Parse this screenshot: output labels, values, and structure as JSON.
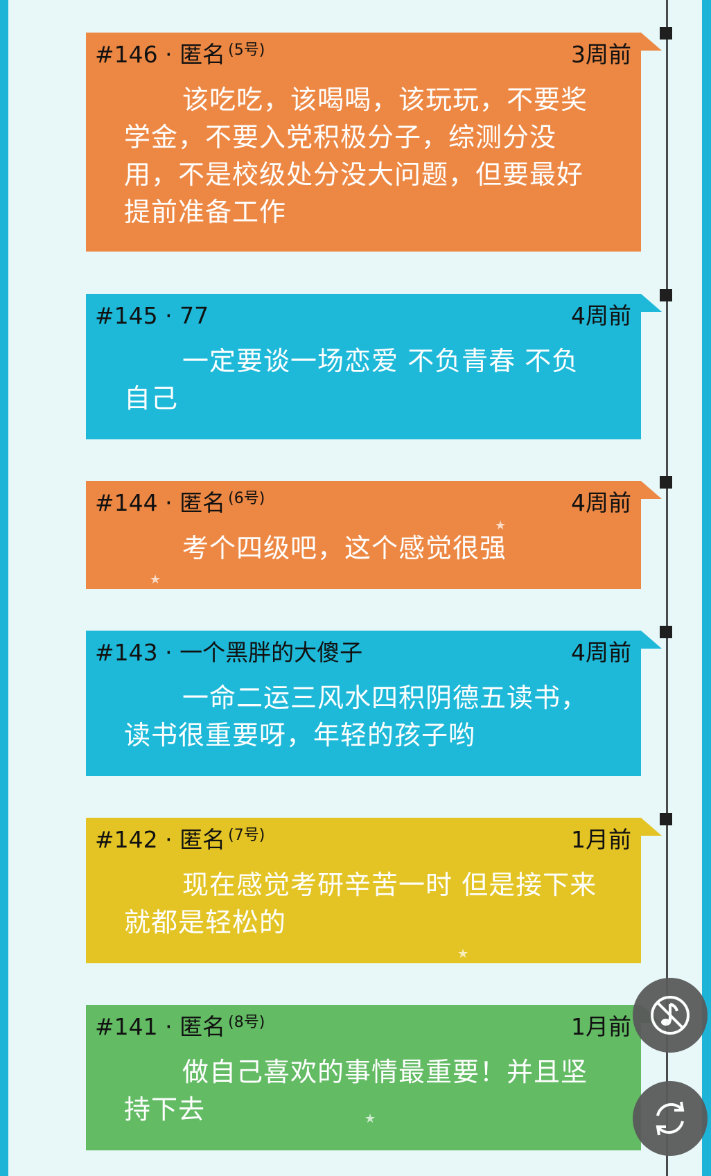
{
  "posts": [
    {
      "id": "#146",
      "sep": " · ",
      "author": "匿名",
      "tag": "(5号)",
      "time": "3周前",
      "text": "该吃吃，该喝喝，该玩玩，不要奖学金，不要入党积极分子，综测分没用，不是校级处分没大问题，但要最好提前准备工作",
      "color": "#ed8844"
    },
    {
      "id": "#145",
      "sep": " · ",
      "author": "77",
      "tag": "",
      "time": "4周前",
      "text": "一定要谈一场恋爱 不负青春 不负自己",
      "color": "#1eb9d9"
    },
    {
      "id": "#144",
      "sep": " · ",
      "author": "匿名",
      "tag": "(6号)",
      "time": "4周前",
      "text": "考个四级吧，这个感觉很强",
      "color": "#ed8844"
    },
    {
      "id": "#143",
      "sep": " · ",
      "author": "一个黑胖的大傻子",
      "tag": "",
      "time": "4周前",
      "text": "一命二运三风水四积阴德五读书，读书很重要呀，年轻的孩子哟",
      "color": "#1eb9d9"
    },
    {
      "id": "#142",
      "sep": " · ",
      "author": "匿名",
      "tag": "(7号)",
      "time": "1月前",
      "text": "现在感觉考研辛苦一时 但是接下来就都是轻松的",
      "color": "#e3c424"
    },
    {
      "id": "#141",
      "sep": " · ",
      "author": "匿名",
      "tag": "(8号)",
      "time": "1月前",
      "text": "做自己喜欢的事情最重要！并且坚持下去",
      "color": "#63bb64"
    }
  ],
  "controls": {
    "music_icon": "music-off-icon",
    "refresh_icon": "refresh-icon"
  },
  "colors": {
    "frame": "#1db4d8",
    "background": "#e8f8f9",
    "timeline": "#4a4a4a"
  }
}
